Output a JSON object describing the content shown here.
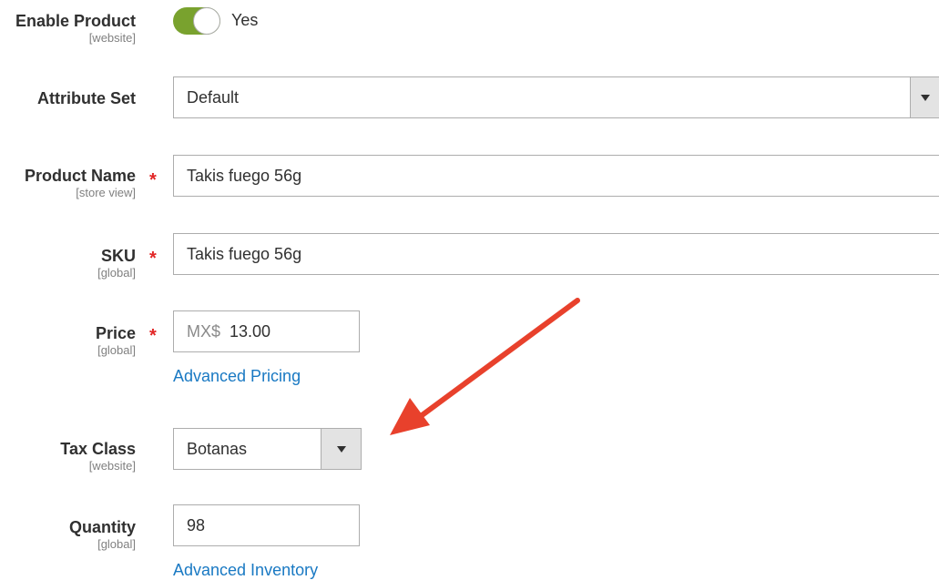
{
  "enable_product": {
    "label": "Enable Product",
    "scope": "[website]",
    "value_text": "Yes",
    "enabled": true
  },
  "attribute_set": {
    "label": "Attribute Set",
    "value": "Default"
  },
  "product_name": {
    "label": "Product Name",
    "scope": "[store view]",
    "required_mark": "*",
    "value": "Takis fuego 56g"
  },
  "sku": {
    "label": "SKU",
    "scope": "[global]",
    "required_mark": "*",
    "value": "Takis fuego 56g"
  },
  "price": {
    "label": "Price",
    "scope": "[global]",
    "required_mark": "*",
    "currency_prefix": "MX$",
    "value": "13.00",
    "advanced_link": "Advanced Pricing"
  },
  "tax_class": {
    "label": "Tax Class",
    "scope": "[website]",
    "value": "Botanas"
  },
  "quantity": {
    "label": "Quantity",
    "scope": "[global]",
    "value": "98",
    "advanced_link": "Advanced Inventory"
  },
  "colors": {
    "toggle_on": "#79a22e",
    "required": "#e22626",
    "link": "#1979c3",
    "annotation_arrow": "#e8412c"
  },
  "icons": {
    "select_caret": "caret-down-icon",
    "annotation": "red-arrow-annotation"
  }
}
